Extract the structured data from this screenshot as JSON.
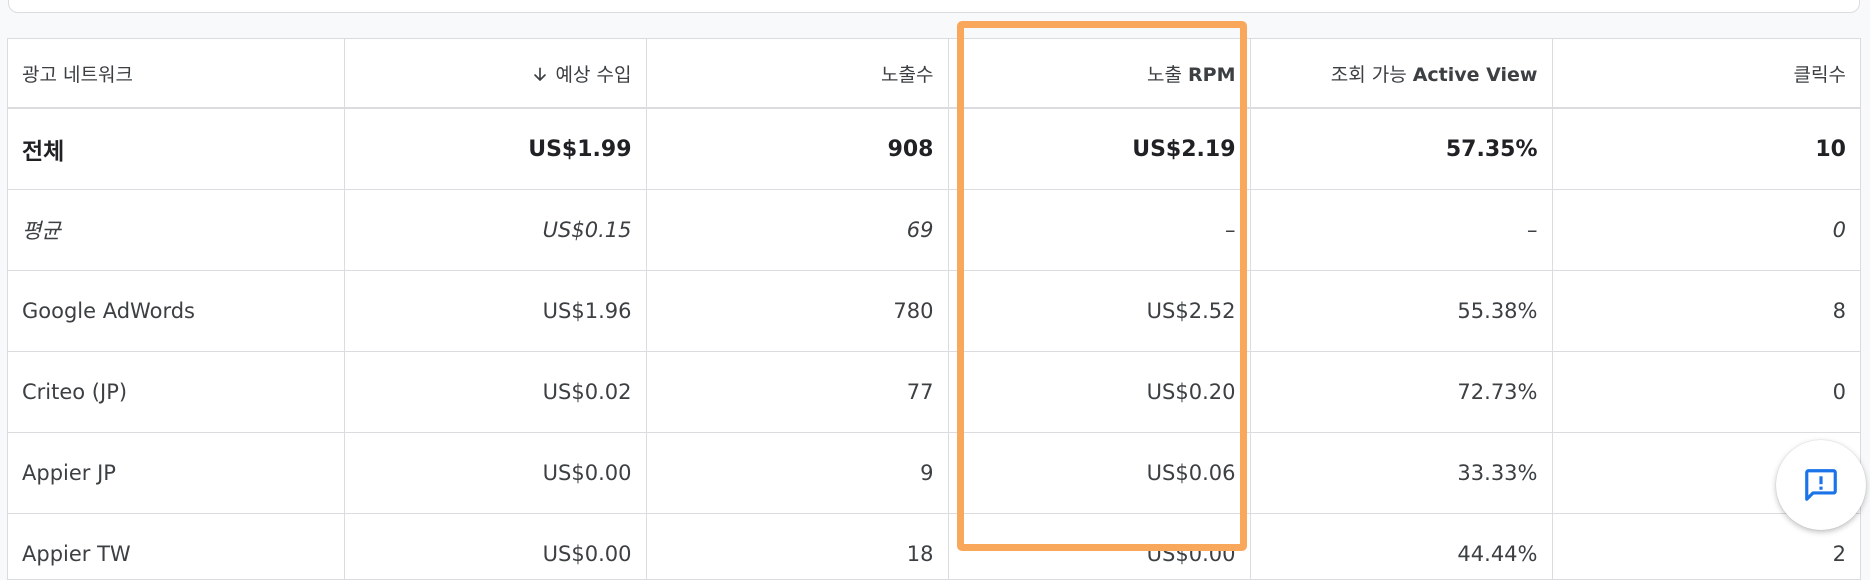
{
  "table": {
    "headers": [
      {
        "ko": "광고 네트워크",
        "en": ""
      },
      {
        "ko": "예상 수입",
        "en": ""
      },
      {
        "ko": "노출수",
        "en": ""
      },
      {
        "ko": "노출 ",
        "en": "RPM"
      },
      {
        "ko": "조회 가능 ",
        "en": "Active View"
      },
      {
        "ko": "클릭수",
        "en": ""
      }
    ],
    "sort_icon": "arrow-down-icon",
    "rows": [
      {
        "type": "total",
        "cells": [
          "전체",
          "US$1.99",
          "908",
          "US$2.19",
          "57.35%",
          "10"
        ]
      },
      {
        "type": "avg",
        "cells": [
          "평균",
          "US$0.15",
          "69",
          "–",
          "–",
          "0"
        ]
      },
      {
        "type": "data",
        "cells": [
          "Google AdWords",
          "US$1.96",
          "780",
          "US$2.52",
          "55.38%",
          "8"
        ]
      },
      {
        "type": "data",
        "cells": [
          "Criteo (JP)",
          "US$0.02",
          "77",
          "US$0.20",
          "72.73%",
          "0"
        ]
      },
      {
        "type": "data",
        "cells": [
          "Appier JP",
          "US$0.00",
          "9",
          "US$0.06",
          "33.33%",
          ""
        ]
      },
      {
        "type": "data",
        "cells": [
          "Appier TW",
          "US$0.00",
          "18",
          "US$0.00",
          "44.44%",
          "2"
        ]
      }
    ]
  },
  "highlight": {
    "color": "#f9a85b",
    "column": "노출 RPM"
  },
  "feedback_button": {
    "icon": "feedback-icon",
    "color": "#1a73e8"
  }
}
